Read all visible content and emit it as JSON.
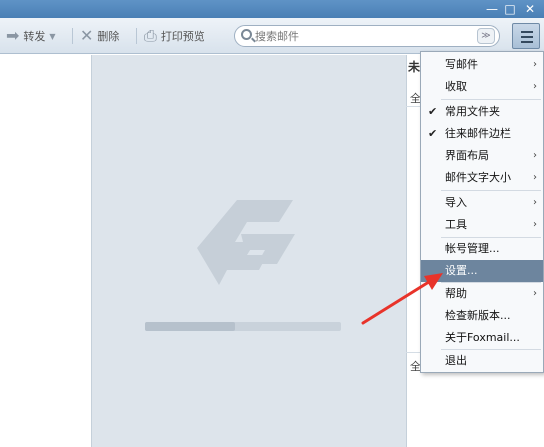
{
  "window": {
    "controls": {
      "minimize": "—",
      "maximize": "□",
      "close": "✕"
    }
  },
  "toolbar": {
    "forward_label": "转发",
    "delete_label": "删除",
    "print_label": "打印预览",
    "icons": {
      "forward": "arrow-right-icon",
      "delete": "delete-x-icon",
      "print": "printer-icon"
    }
  },
  "search": {
    "placeholder": "搜索邮件",
    "options_glyph": "≫"
  },
  "sidebar": {
    "header": "未",
    "tab_top": "全",
    "tab_bottom": "全"
  },
  "menu": {
    "items": [
      {
        "label": "写邮件",
        "submenu": true
      },
      {
        "label": "收取",
        "submenu": true
      },
      {
        "label": "常用文件夹",
        "checked": true
      },
      {
        "label": "往来邮件边栏",
        "checked": true
      },
      {
        "label": "界面布局",
        "submenu": true
      },
      {
        "label": "邮件文字大小",
        "submenu": true
      },
      {
        "label": "导入",
        "submenu": true
      },
      {
        "label": "工具",
        "submenu": true
      },
      {
        "label": "帐号管理..."
      },
      {
        "label": "设置...",
        "highlighted": true
      },
      {
        "label": "帮助",
        "submenu": true
      },
      {
        "label": "检查新版本..."
      },
      {
        "label": "关于Foxmail..."
      },
      {
        "label": "退出"
      }
    ]
  },
  "colors": {
    "titlebar": "#4a7fb5",
    "highlight": "#6d859e",
    "annotation_arrow": "#e8332a",
    "list_pane": "#dde4eb",
    "logo": "#c6cfd8"
  },
  "loading": {
    "progress": 0.46
  }
}
